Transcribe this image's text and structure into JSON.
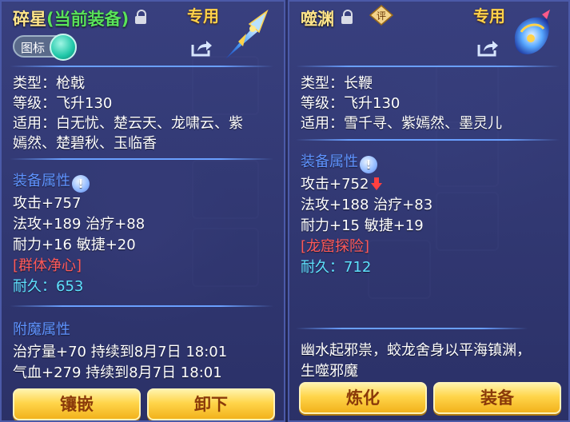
{
  "left": {
    "title": "碎星",
    "title_sub": "(当前装备)",
    "special": "专用",
    "toggle_label": "图标",
    "type": "类型：枪戟",
    "level": "等级：飞升130",
    "applies_1": "适用：白无忧、楚云天、龙啸云、紫",
    "applies_2": "嫣然、楚碧秋、玉临香",
    "attr_title": "装备属性",
    "attack": "攻击+757",
    "magic_heal": "法攻+189 治疗+88",
    "stamina_agility": "耐力+16 敏捷+20",
    "tag": "[群体净心]",
    "durability": "耐久：653",
    "enchant_title": "附魔属性",
    "enchant_1": "治疗量+70 持续到8月7日 18:01",
    "enchant_2": "气血+279 持续到8月7日 18:01",
    "btn_inlay": "镶嵌",
    "btn_unequip": "卸下"
  },
  "right": {
    "title": "噬渊",
    "rating": "评",
    "special": "专用",
    "type": "类型：长鞭",
    "level": "等级：飞升130",
    "applies": "适用：雪千寻、紫嫣然、墨灵儿",
    "attr_title": "装备属性",
    "attack": "攻击+752",
    "magic_heal": "法攻+188 治疗+83",
    "stamina_agility": "耐力+15 敏捷+19",
    "tag": "[龙窟探险]",
    "durability": "耐久：712",
    "desc_1": "幽水起邪祟，蛟龙舍身以平海镇渊，",
    "desc_2": "生噬邪魔",
    "btn_refine": "炼化",
    "btn_equip": "装备"
  },
  "colors": {
    "title": "#ffe58a",
    "equipped": "#59e35a",
    "section": "#5f93ff",
    "tag": "#ff5a5a",
    "durability": "#5fe2ff",
    "button": "#ffd54a"
  }
}
